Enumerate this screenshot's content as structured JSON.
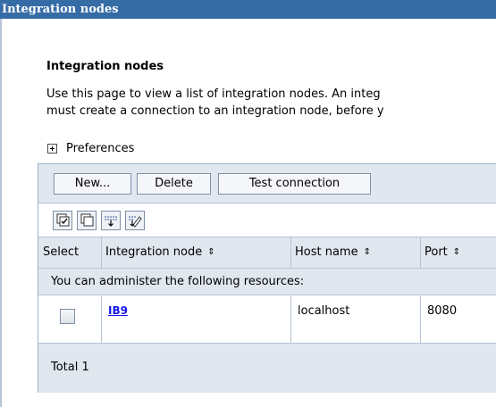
{
  "window": {
    "title": "Integration nodes"
  },
  "page": {
    "heading": "Integration nodes",
    "description_line1": "Use this page to view a list of integration nodes. An integ",
    "description_line2": "must create a connection to an integration node, before y"
  },
  "preferences": {
    "label": "Preferences",
    "icon": "plus-expand-icon"
  },
  "toolbar": {
    "new_label": "New...",
    "delete_label": "Delete",
    "test_connection_label": "Test connection"
  },
  "icon_toolbar": {
    "icons": [
      "select-all-icon",
      "deselect-all-icon",
      "expand-filter-icon",
      "clear-filter-icon"
    ]
  },
  "table": {
    "columns": [
      "Select",
      "Integration node",
      "Host name",
      "Port"
    ],
    "resource_message": "You can administer the following resources:",
    "rows": [
      {
        "name": "IB9",
        "host": "localhost",
        "port": "8080"
      }
    ],
    "total": "Total 1"
  },
  "colors": {
    "titlebar": "#356ca6",
    "panel": "#e1e7ef",
    "link": "#1515e6"
  }
}
